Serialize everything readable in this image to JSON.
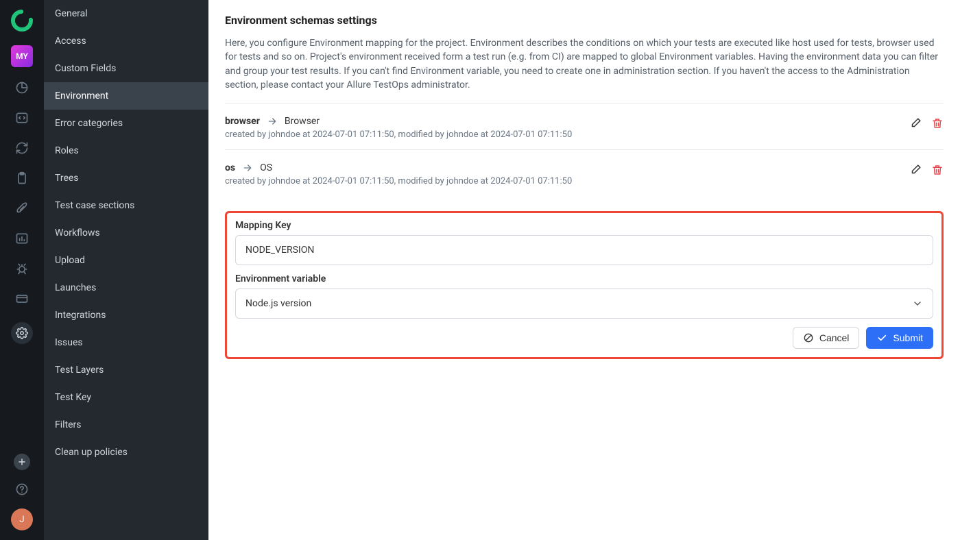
{
  "rail": {
    "project_badge": "MY",
    "user_initial": "J"
  },
  "sidebar": {
    "items": [
      "General",
      "Access",
      "Custom Fields",
      "Environment",
      "Error categories",
      "Roles",
      "Trees",
      "Test case sections",
      "Workflows",
      "Upload",
      "Launches",
      "Integrations",
      "Issues",
      "Test Layers",
      "Test Key",
      "Filters",
      "Clean up policies"
    ],
    "active_index": 3
  },
  "main": {
    "title": "Environment schemas settings",
    "description": "Here, you configure Environment mapping for the project. Environment describes the conditions on which your tests are executed like host used for tests, browser used for tests and so on. Project's environment received form a test run (e.g. from CI) are mapped to global Environment variables. Having the environment data you can filter and group your test results. If you can't find Environment variable, you need to create one in administration section. If you haven't the access to the Administration section, please contact your Allure TestOps administrator.",
    "mappings": [
      {
        "key": "browser",
        "value": "Browser",
        "meta": "created by johndoe at 2024-07-01 07:11:50, modified by johndoe at 2024-07-01 07:11:50"
      },
      {
        "key": "os",
        "value": "OS",
        "meta": "created by johndoe at 2024-07-01 07:11:50, modified by johndoe at 2024-07-01 07:11:50"
      }
    ],
    "form": {
      "mapping_key_label": "Mapping Key",
      "mapping_key_value": "NODE_VERSION",
      "env_var_label": "Environment variable",
      "env_var_value": "Node.js version",
      "cancel": "Cancel",
      "submit": "Submit"
    }
  }
}
